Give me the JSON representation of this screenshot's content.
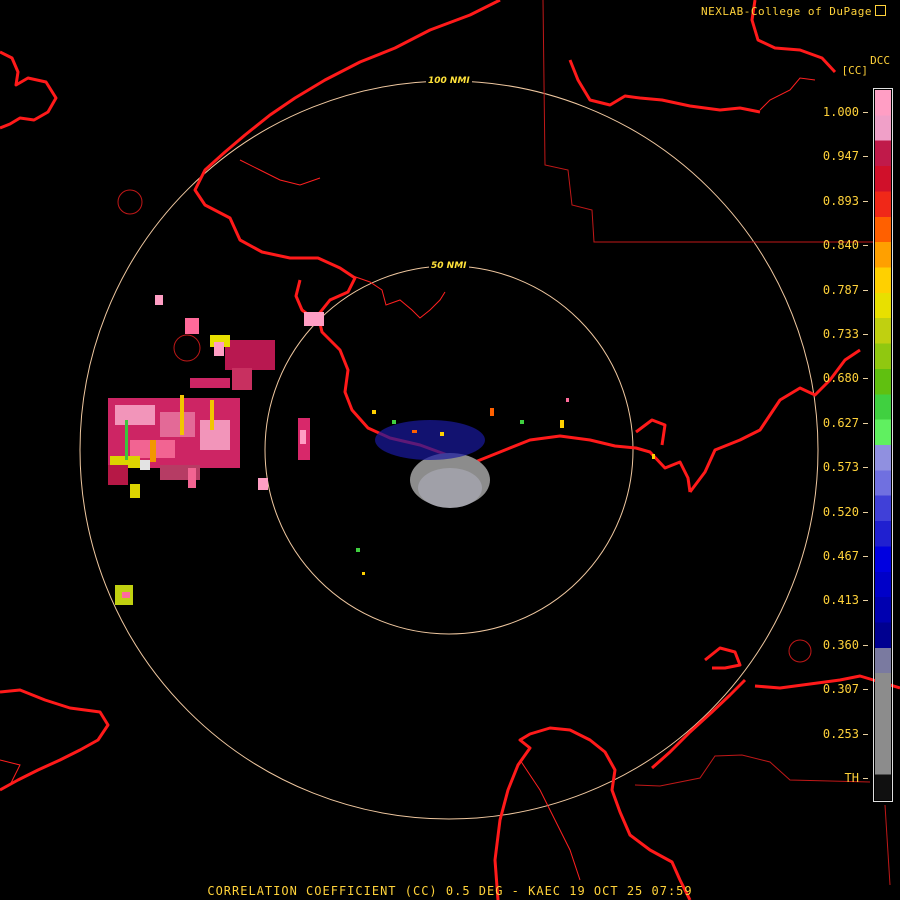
{
  "credit": "NEXLAB-College of DuPage",
  "unit_code": "DCC",
  "unit": "[CC]",
  "ring_labels": {
    "inner": "50 NMI",
    "outer": "100 NMI"
  },
  "colorbar": {
    "ticks": [
      "1.000",
      "0.947",
      "0.893",
      "0.840",
      "0.787",
      "0.733",
      "0.680",
      "0.627",
      "0.573",
      "0.520",
      "0.467",
      "0.413",
      "0.360",
      "0.307",
      "0.253",
      "TH"
    ],
    "colors": [
      "#ff9ec4",
      "#f0a0c8",
      "#c01a4a",
      "#d0102a",
      "#f02818",
      "#ff6000",
      "#ffa000",
      "#ffd000",
      "#e8e000",
      "#c0d010",
      "#90c810",
      "#60c010",
      "#40d040",
      "#60f060",
      "#9090e0",
      "#7070e0",
      "#4040d8",
      "#2020d0",
      "#0000e0",
      "#0000c8",
      "#0000b0",
      "#000090",
      "#7a7aa0",
      "#8c8c8c",
      "#8c8c8c",
      "#8c8c8c",
      "#8c8c8c",
      "#101010"
    ]
  },
  "footer": "CORRELATION COEFFICIENT (CC) 0.5 DEG - KAEC 19 OCT 25 07:59"
}
